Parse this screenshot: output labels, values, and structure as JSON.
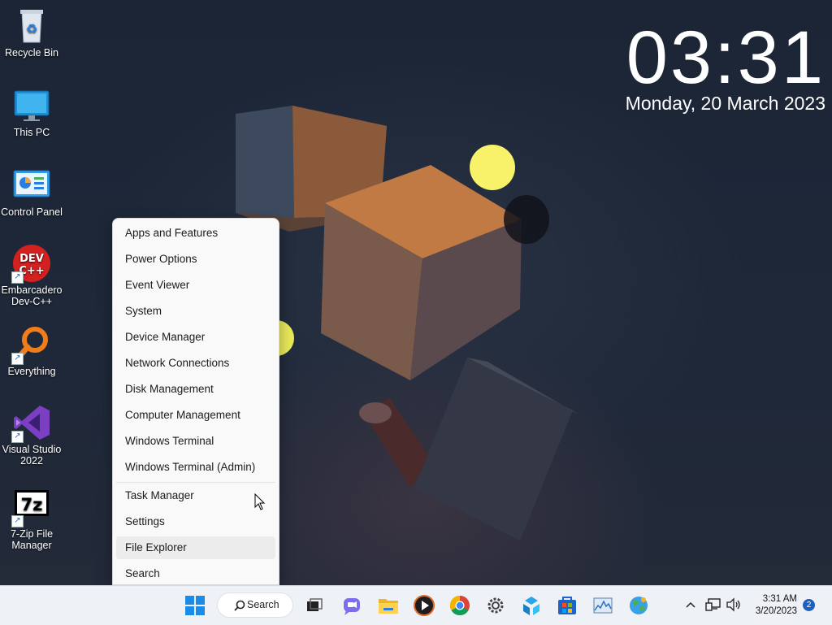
{
  "colors": {
    "accent": "#0067c0",
    "menu_bg": "#f9f9f9",
    "taskbar_bg": "#eef1f6",
    "notification_badge": "#1f5fbf"
  },
  "clock": {
    "time": "03:31",
    "date": "Monday, 20 March 2023"
  },
  "desktop_icons": [
    {
      "label": "Recycle Bin",
      "icon": "recycle-bin-icon",
      "shortcut": false
    },
    {
      "label": "This PC",
      "icon": "monitor-icon",
      "shortcut": false
    },
    {
      "label": "Control Panel",
      "icon": "control-panel-icon",
      "shortcut": false
    },
    {
      "label": "Embarcadero Dev-C++",
      "line1": "Embarcadero",
      "line2": "Dev-C++",
      "icon": "devcpp-icon",
      "shortcut": true
    },
    {
      "label": "Everything",
      "icon": "everything-search-icon",
      "shortcut": true
    },
    {
      "label": "Visual Studio 2022",
      "line1": "Visual Studio",
      "line2": "2022",
      "icon": "visual-studio-icon",
      "shortcut": true
    },
    {
      "label": "7-Zip File Manager",
      "line1": "7-Zip File",
      "line2": "Manager",
      "icon": "7zip-icon",
      "shortcut": true
    }
  ],
  "context_menu": {
    "items": [
      "Apps and Features",
      "Power Options",
      "Event Viewer",
      "System",
      "Device Manager",
      "Network Connections",
      "Disk Management",
      "Computer Management",
      "Windows Terminal",
      "Windows Terminal (Admin)",
      "Task Manager",
      "Settings",
      "File Explorer",
      "Search"
    ],
    "hovered": "File Explorer"
  },
  "taskbar": {
    "search_label": "Search",
    "apps": [
      "start-icon",
      "task-view-icon",
      "chat-icon",
      "file-explorer-icon",
      "media-player-icon",
      "chrome-icon",
      "settings-gear-icon",
      "remote-desktop-icon",
      "store-icon",
      "resource-monitor-icon",
      "globe-app-icon"
    ],
    "tray": {
      "time": "3:31 AM",
      "date": "3/20/2023",
      "notifications": "2"
    }
  }
}
